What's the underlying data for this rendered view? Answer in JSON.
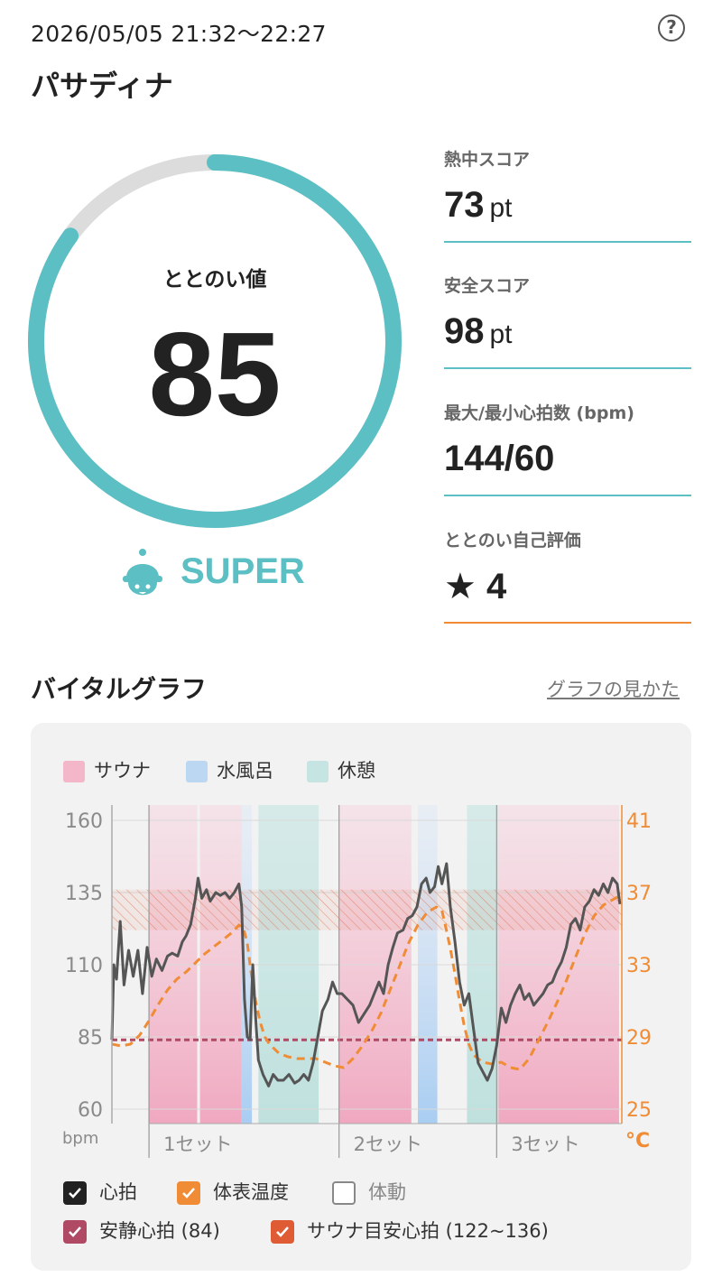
{
  "header": {
    "datetime": "2026/05/05 21:32～22:27",
    "help_icon": "?",
    "place": "パサディナ"
  },
  "score": {
    "label": "ととのい値",
    "value": "85",
    "progress": 0.85,
    "rank": "SUPER",
    "rank_icon": "sauna-hat-face-icon"
  },
  "stats": [
    {
      "label": "熱中スコア",
      "value": "73",
      "unit": "pt"
    },
    {
      "label": "安全スコア",
      "value": "98",
      "unit": "pt"
    },
    {
      "label": "最大/最小心拍数 (bpm)",
      "value": "144/60",
      "unit": ""
    },
    {
      "label": "ととのい自己評価",
      "value": "★ 4",
      "unit": ""
    }
  ],
  "vital": {
    "title": "バイタルグラフ",
    "guide_link": "グラフの見かた"
  },
  "legend": [
    {
      "label": "サウナ",
      "color": "#f3b7c9"
    },
    {
      "label": "水風呂",
      "color": "#bcd7f2"
    },
    {
      "label": "休憩",
      "color": "#c6e4e2"
    }
  ],
  "toggles": [
    {
      "label": "心拍",
      "checked": true,
      "color": "#222222"
    },
    {
      "label": "体表温度",
      "checked": true,
      "color": "#ef8c35"
    },
    {
      "label": "体動",
      "checked": false,
      "color": "#888888"
    },
    {
      "label": "安静心拍 (84)",
      "checked": true,
      "color": "#b04a64"
    },
    {
      "label": "サウナ目安心拍 (122~136)",
      "checked": true,
      "color": "#de5b34"
    }
  ],
  "colors": {
    "accent": "#5bbfc4",
    "gauge_track": "#dcdcdc",
    "orange": "#ef8c35",
    "resting": "#b04a64",
    "zone": "#de5b34"
  },
  "chart_data": {
    "type": "line",
    "x_unit": "min",
    "xlim": [
      0,
      55
    ],
    "ylabel_left": "bpm",
    "ylabel_right": "°C",
    "y_left_ticks": [
      "160",
      "135",
      "110",
      "85",
      "60"
    ],
    "y_right_ticks": [
      "41",
      "37",
      "33",
      "29",
      "25"
    ],
    "ylim_left": [
      60,
      160
    ],
    "ylim_right": [
      25,
      41
    ],
    "set_labels": [
      "1セット",
      "2セット",
      "3セット"
    ],
    "set_ranges": [
      [
        4,
        24.5
      ],
      [
        24.5,
        41.5
      ],
      [
        41.5,
        55
      ]
    ],
    "sessions": [
      {
        "type": "sauna",
        "start": 4.0,
        "end": 9.2
      },
      {
        "type": "sauna",
        "start": 9.5,
        "end": 14.0
      },
      {
        "type": "cold",
        "start": 14.0,
        "end": 15.1
      },
      {
        "type": "rest",
        "start": 15.8,
        "end": 22.3
      },
      {
        "type": "sauna",
        "start": 24.5,
        "end": 32.3
      },
      {
        "type": "cold",
        "start": 33.0,
        "end": 35.1
      },
      {
        "type": "rest",
        "start": 38.3,
        "end": 41.7
      },
      {
        "type": "sauna",
        "start": 41.7,
        "end": 54.7
      }
    ],
    "resting_hr": 84,
    "sauna_zone": [
      122,
      136
    ],
    "series": [
      {
        "name": "心拍",
        "points": [
          [
            0,
            84
          ],
          [
            0.2,
            110
          ],
          [
            0.5,
            105
          ],
          [
            0.9,
            125
          ],
          [
            1.3,
            103
          ],
          [
            1.8,
            115
          ],
          [
            2.3,
            106
          ],
          [
            2.8,
            115
          ],
          [
            3.3,
            100
          ],
          [
            3.8,
            116
          ],
          [
            4.3,
            106
          ],
          [
            4.8,
            112
          ],
          [
            5.4,
            108
          ],
          [
            6.0,
            113
          ],
          [
            6.5,
            114
          ],
          [
            7.1,
            113
          ],
          [
            7.6,
            118
          ],
          [
            8.0,
            120
          ],
          [
            8.5,
            124
          ],
          [
            9.0,
            133
          ],
          [
            9.3,
            140
          ],
          [
            9.7,
            133
          ],
          [
            10.2,
            136
          ],
          [
            10.6,
            132
          ],
          [
            11.2,
            135
          ],
          [
            11.7,
            134
          ],
          [
            12.2,
            135
          ],
          [
            12.7,
            133
          ],
          [
            13.2,
            135
          ],
          [
            13.7,
            138
          ],
          [
            14.0,
            130
          ],
          [
            14.3,
            98
          ],
          [
            14.6,
            85
          ],
          [
            14.9,
            84
          ],
          [
            15.2,
            110
          ],
          [
            15.5,
            92
          ],
          [
            15.8,
            77
          ],
          [
            16.3,
            72
          ],
          [
            16.9,
            68
          ],
          [
            17.4,
            72
          ],
          [
            17.9,
            70
          ],
          [
            18.5,
            70
          ],
          [
            19.1,
            72
          ],
          [
            19.7,
            69
          ],
          [
            20.2,
            70
          ],
          [
            20.7,
            72
          ],
          [
            21.2,
            70
          ],
          [
            21.7,
            76
          ],
          [
            22.2,
            85
          ],
          [
            22.7,
            94
          ],
          [
            23.3,
            98
          ],
          [
            23.8,
            104
          ],
          [
            24.3,
            100
          ],
          [
            24.8,
            100
          ],
          [
            25.4,
            98
          ],
          [
            26.0,
            96
          ],
          [
            26.6,
            90
          ],
          [
            27.2,
            93
          ],
          [
            27.8,
            96
          ],
          [
            28.3,
            100
          ],
          [
            28.8,
            104
          ],
          [
            29.3,
            100
          ],
          [
            29.8,
            110
          ],
          [
            30.3,
            116
          ],
          [
            30.8,
            121
          ],
          [
            31.4,
            122
          ],
          [
            31.9,
            126
          ],
          [
            32.4,
            127
          ],
          [
            32.9,
            130
          ],
          [
            33.4,
            138
          ],
          [
            33.9,
            140
          ],
          [
            34.3,
            135
          ],
          [
            34.8,
            137
          ],
          [
            35.2,
            144
          ],
          [
            35.6,
            138
          ],
          [
            36.1,
            145
          ],
          [
            36.5,
            130
          ],
          [
            37.0,
            118
          ],
          [
            37.5,
            104
          ],
          [
            38.0,
            96
          ],
          [
            38.5,
            100
          ],
          [
            39.0,
            88
          ],
          [
            39.5,
            76
          ],
          [
            40.0,
            73
          ],
          [
            40.5,
            70
          ],
          [
            41.0,
            74
          ],
          [
            41.5,
            82
          ],
          [
            42.0,
            95
          ],
          [
            42.5,
            90
          ],
          [
            43.0,
            96
          ],
          [
            43.5,
            100
          ],
          [
            44.0,
            103
          ],
          [
            44.5,
            98
          ],
          [
            45.0,
            100
          ],
          [
            45.5,
            96
          ],
          [
            46.0,
            98
          ],
          [
            46.5,
            100
          ],
          [
            47.0,
            103
          ],
          [
            47.5,
            104
          ],
          [
            48.0,
            108
          ],
          [
            48.5,
            111
          ],
          [
            49.0,
            116
          ],
          [
            49.5,
            124
          ],
          [
            50.0,
            126
          ],
          [
            50.5,
            122
          ],
          [
            51.0,
            130
          ],
          [
            51.5,
            132
          ],
          [
            52.0,
            136
          ],
          [
            52.5,
            134
          ],
          [
            53.0,
            138
          ],
          [
            53.5,
            135
          ],
          [
            54.0,
            140
          ],
          [
            54.5,
            138
          ],
          [
            54.8,
            131
          ]
        ]
      },
      {
        "name": "体表温度",
        "axis": "right",
        "points": [
          [
            0,
            28.6
          ],
          [
            1.0,
            28.5
          ],
          [
            2.0,
            28.6
          ],
          [
            3.0,
            29.1
          ],
          [
            4.0,
            29.9
          ],
          [
            5.0,
            30.8
          ],
          [
            6.0,
            31.6
          ],
          [
            7.0,
            32.2
          ],
          [
            8.0,
            32.6
          ],
          [
            9.0,
            33.1
          ],
          [
            10.0,
            33.6
          ],
          [
            11.0,
            34.0
          ],
          [
            12.0,
            34.4
          ],
          [
            13.0,
            34.8
          ],
          [
            13.7,
            35.2
          ],
          [
            14.2,
            35.0
          ],
          [
            14.6,
            34.2
          ],
          [
            15.0,
            32.6
          ],
          [
            15.5,
            31.0
          ],
          [
            16.0,
            29.8
          ],
          [
            16.5,
            29.0
          ],
          [
            17.0,
            28.6
          ],
          [
            18.0,
            28.1
          ],
          [
            19.0,
            27.9
          ],
          [
            20.0,
            27.8
          ],
          [
            21.0,
            27.8
          ],
          [
            22.0,
            27.8
          ],
          [
            23.0,
            27.6
          ],
          [
            24.0,
            27.4
          ],
          [
            25.0,
            27.3
          ],
          [
            26.0,
            27.8
          ],
          [
            27.0,
            28.5
          ],
          [
            28.0,
            29.3
          ],
          [
            29.0,
            30.3
          ],
          [
            30.0,
            31.6
          ],
          [
            31.0,
            32.9
          ],
          [
            32.0,
            34.2
          ],
          [
            33.0,
            35.2
          ],
          [
            34.0,
            35.9
          ],
          [
            35.0,
            36.2
          ],
          [
            35.6,
            36.0
          ],
          [
            36.0,
            35.1
          ],
          [
            36.5,
            33.9
          ],
          [
            37.0,
            32.5
          ],
          [
            37.5,
            31.0
          ],
          [
            38.0,
            29.6
          ],
          [
            38.5,
            28.6
          ],
          [
            39.0,
            28.0
          ],
          [
            40.0,
            27.6
          ],
          [
            41.0,
            27.5
          ],
          [
            42.0,
            27.6
          ],
          [
            43.0,
            27.3
          ],
          [
            44.0,
            27.2
          ],
          [
            45.0,
            27.8
          ],
          [
            46.0,
            28.8
          ],
          [
            47.0,
            29.8
          ],
          [
            48.0,
            30.9
          ],
          [
            49.0,
            32.1
          ],
          [
            50.0,
            33.4
          ],
          [
            51.0,
            34.7
          ],
          [
            52.0,
            35.7
          ],
          [
            53.0,
            36.3
          ],
          [
            54.0,
            36.6
          ],
          [
            54.7,
            36.8
          ]
        ]
      }
    ]
  }
}
